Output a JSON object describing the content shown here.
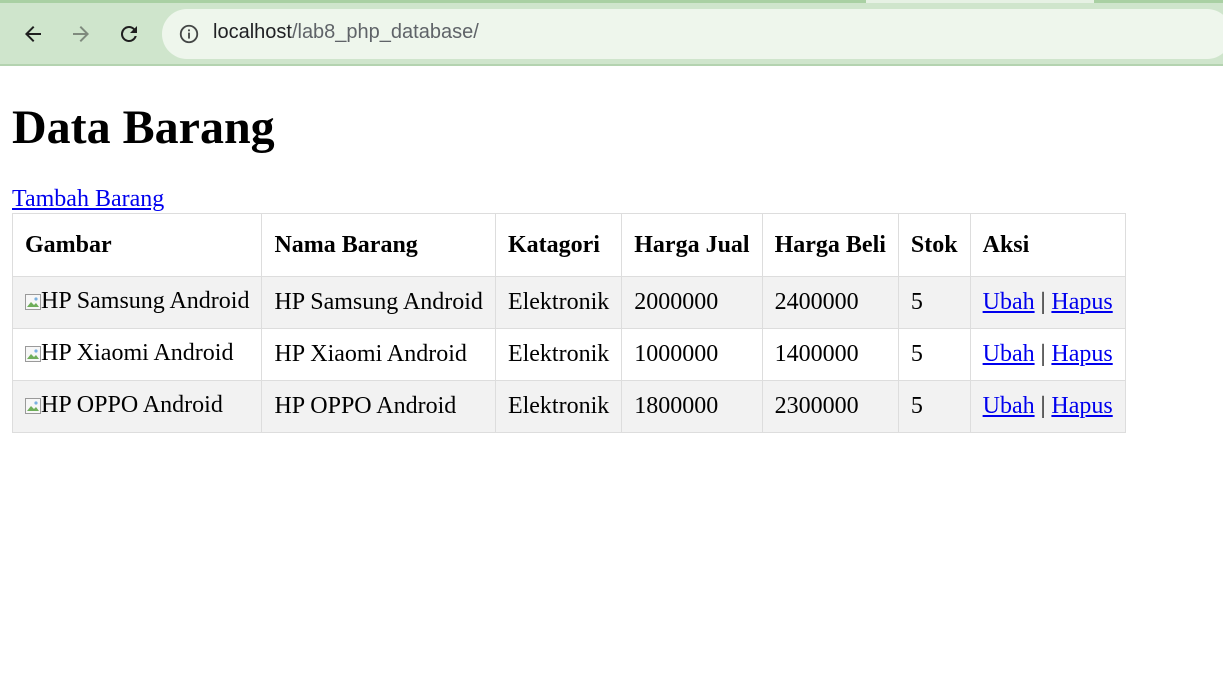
{
  "browser": {
    "url_host": "localhost",
    "url_path": "/lab8_php_database/",
    "icons": {
      "back": "back-arrow-icon",
      "forward": "forward-arrow-icon",
      "reload": "reload-icon",
      "site_info": "info-icon"
    }
  },
  "page": {
    "title": "Data Barang",
    "add_link": "Tambah Barang"
  },
  "table": {
    "headers": [
      "Gambar",
      "Nama Barang",
      "Katagori",
      "Harga Jual",
      "Harga Beli",
      "Stok",
      "Aksi"
    ],
    "rows": [
      {
        "gambar_alt": "HP Samsung Android",
        "nama": "HP Samsung Android",
        "kategori": "Elektronik",
        "harga_jual": "2000000",
        "harga_beli": "2400000",
        "stok": "5",
        "ubah": "Ubah",
        "sep": "|",
        "hapus": "Hapus"
      },
      {
        "gambar_alt": "HP Xiaomi Android",
        "nama": "HP Xiaomi Android",
        "kategori": "Elektronik",
        "harga_jual": "1000000",
        "harga_beli": "1400000",
        "stok": "5",
        "ubah": "Ubah",
        "sep": "|",
        "hapus": "Hapus"
      },
      {
        "gambar_alt": "HP OPPO Android",
        "nama": "HP OPPO Android",
        "kategori": "Elektronik",
        "harga_jual": "1800000",
        "harga_beli": "2300000",
        "stok": "5",
        "ubah": "Ubah",
        "sep": "|",
        "hapus": "Hapus"
      }
    ]
  },
  "colors": {
    "toolbar": "#cfe5cc",
    "omnibox": "#eef6ec",
    "link": "#0000ee",
    "row_alt": "#f2f2f2",
    "border": "#dddddd"
  }
}
